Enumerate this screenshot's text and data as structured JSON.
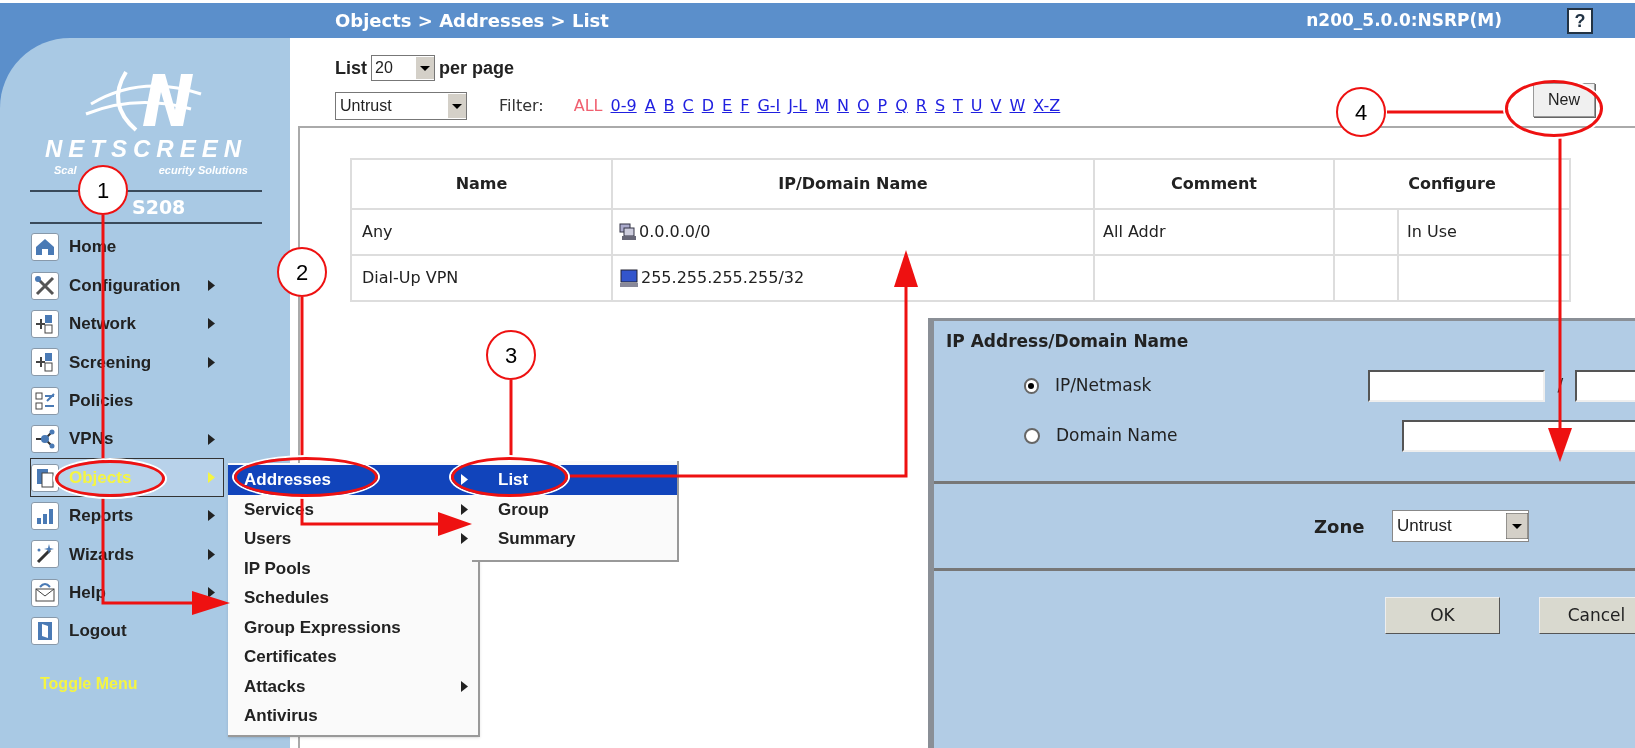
{
  "header": {
    "breadcrumb": "Objects > Addresses > List",
    "device": "n200_5.0.0:NSRP(M)",
    "help": "?"
  },
  "sidebar": {
    "brand": "NETSCREEN",
    "tagline": [
      "Scal",
      "ecurity Solutions"
    ],
    "model": "S208",
    "items": [
      {
        "label": "Home",
        "submenu": false,
        "selected": false
      },
      {
        "label": "Configuration",
        "submenu": true,
        "selected": false
      },
      {
        "label": "Network",
        "submenu": true,
        "selected": false
      },
      {
        "label": "Screening",
        "submenu": true,
        "selected": false
      },
      {
        "label": "Policies",
        "submenu": false,
        "selected": false
      },
      {
        "label": "VPNs",
        "submenu": true,
        "selected": false
      },
      {
        "label": "Objects",
        "submenu": true,
        "selected": true
      },
      {
        "label": "Reports",
        "submenu": true,
        "selected": false
      },
      {
        "label": "Wizards",
        "submenu": true,
        "selected": false
      },
      {
        "label": "Help",
        "submenu": true,
        "selected": false
      },
      {
        "label": "Logout",
        "submenu": false,
        "selected": false
      }
    ],
    "toggle": "Toggle Menu"
  },
  "toolbar": {
    "list_label": "List",
    "page_size": "20",
    "per_page": "per page",
    "zone": "Untrust",
    "filter_label": "Filter:",
    "filters": [
      {
        "label": "ALL",
        "selected": true
      },
      {
        "label": "0-9",
        "selected": false
      },
      {
        "label": "A",
        "selected": false
      },
      {
        "label": "B",
        "selected": false
      },
      {
        "label": "C",
        "selected": false
      },
      {
        "label": "D",
        "selected": false
      },
      {
        "label": "E",
        "selected": false
      },
      {
        "label": "F",
        "selected": false
      },
      {
        "label": "G-I",
        "selected": false
      },
      {
        "label": "J-L",
        "selected": false
      },
      {
        "label": "M",
        "selected": false
      },
      {
        "label": "N",
        "selected": false
      },
      {
        "label": "O",
        "selected": false
      },
      {
        "label": "P",
        "selected": false
      },
      {
        "label": "Q",
        "selected": false
      },
      {
        "label": "R",
        "selected": false
      },
      {
        "label": "S",
        "selected": false
      },
      {
        "label": "T",
        "selected": false
      },
      {
        "label": "U",
        "selected": false
      },
      {
        "label": "V",
        "selected": false
      },
      {
        "label": "W",
        "selected": false
      },
      {
        "label": "X-Z",
        "selected": false
      }
    ],
    "new_button": "New"
  },
  "table": {
    "columns": [
      "Name",
      "IP/Domain Name",
      "Comment",
      "Configure"
    ],
    "rows": [
      {
        "name": "Any",
        "address": "0.0.0.0/0",
        "kind": "network",
        "comment": "All Addr",
        "configure": "In Use"
      },
      {
        "name": "Dial-Up VPN",
        "address": "255.255.255.255/32",
        "kind": "host"
      }
    ]
  },
  "objects_menu": [
    {
      "label": "Addresses",
      "submenu": true,
      "selected": true
    },
    {
      "label": "Services",
      "submenu": true,
      "selected": false
    },
    {
      "label": "Users",
      "submenu": true,
      "selected": false
    },
    {
      "label": "IP Pools",
      "submenu": false,
      "selected": false
    },
    {
      "label": "Schedules",
      "submenu": false,
      "selected": false
    },
    {
      "label": "Group Expressions",
      "submenu": false,
      "selected": false
    },
    {
      "label": "Certificates",
      "submenu": false,
      "selected": false
    },
    {
      "label": "Attacks",
      "submenu": true,
      "selected": false
    },
    {
      "label": "Antivirus",
      "submenu": false,
      "selected": false
    }
  ],
  "addresses_menu": [
    {
      "label": "List",
      "selected": true
    },
    {
      "label": "Group",
      "selected": false
    },
    {
      "label": "Summary",
      "selected": false
    }
  ],
  "dialog": {
    "title": "IP Address/Domain Name",
    "options": [
      {
        "label": "IP/Netmask",
        "selected": true
      },
      {
        "label": "Domain Name",
        "selected": false
      }
    ],
    "separator": "/",
    "zone_label": "Zone",
    "zone": "Untrust",
    "buttons": [
      "OK",
      "Cancel"
    ]
  },
  "callouts": [
    "1",
    "2",
    "3",
    "4"
  ]
}
